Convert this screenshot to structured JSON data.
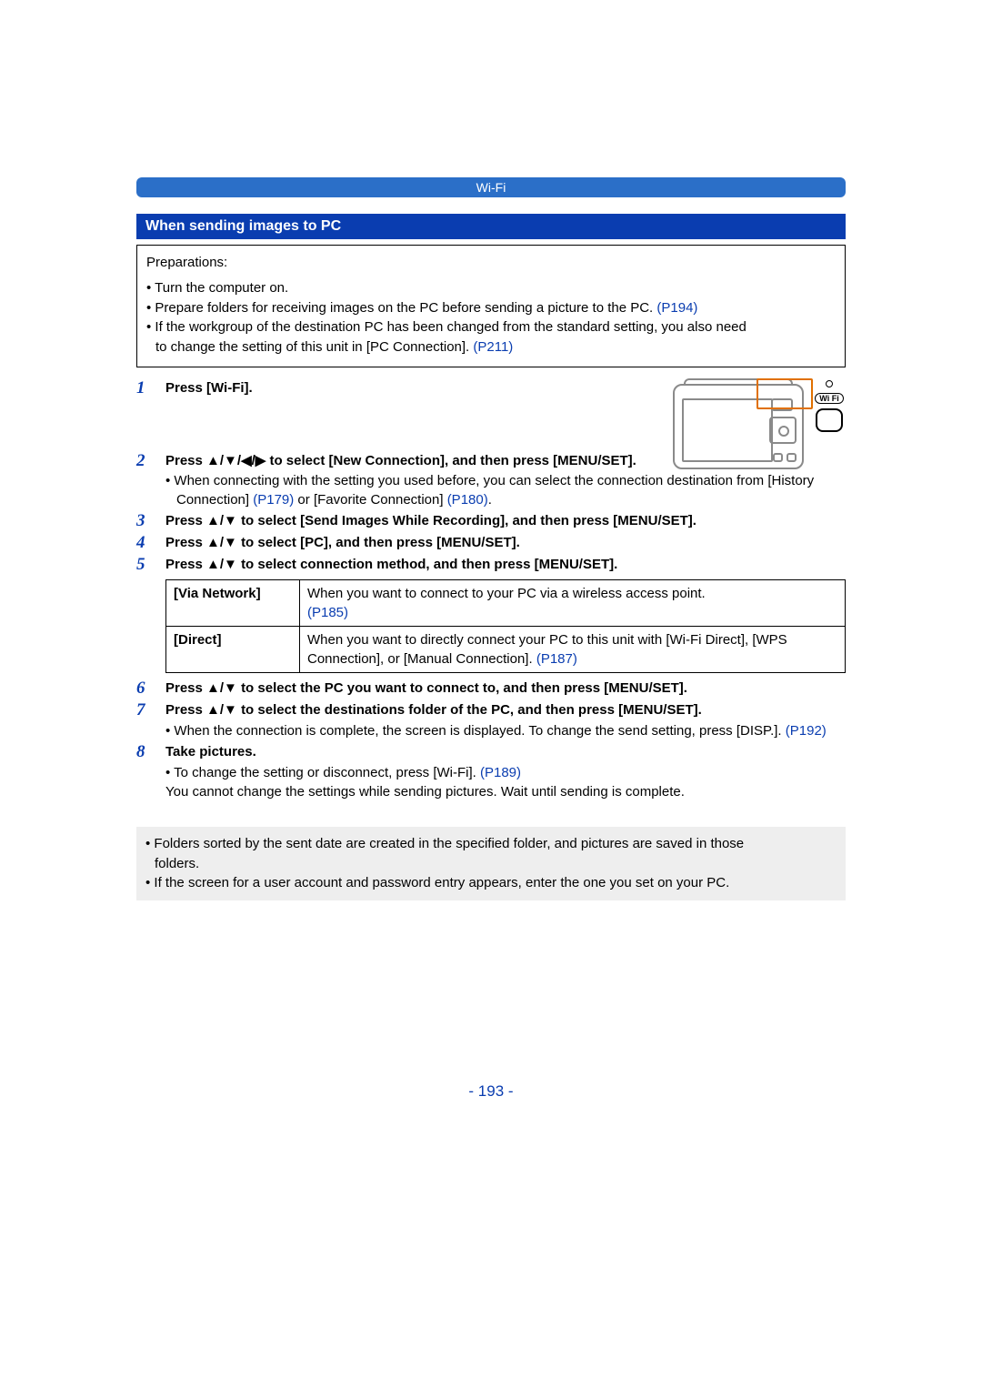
{
  "header": {
    "category": "Wi-Fi"
  },
  "section_title": "When sending images to PC",
  "preparations": {
    "title": "Preparations:",
    "items": [
      {
        "text": "Turn the computer on."
      },
      {
        "text_before": "Prepare folders for receiving images on the PC before sending a picture to the PC. ",
        "link": "(P194)"
      },
      {
        "text_before": "If the workgroup of the destination PC has been changed from the standard setting, you also need",
        "text_cont": "to change the setting of this unit in [PC Connection]. ",
        "link": "(P211)"
      }
    ]
  },
  "steps": [
    {
      "n": "1",
      "bold": "Press [Wi-Fi]."
    },
    {
      "n": "2",
      "bold": "Press ▲/▼/◀/▶ to select [New Connection], and then press [MENU/SET].",
      "note_before": "When connecting with the setting you used before, you can select the connection destination from [History Connection] ",
      "link1": "(P179)",
      "note_mid": " or [Favorite Connection] ",
      "link2": "(P180)",
      "note_after": "."
    },
    {
      "n": "3",
      "bold": "Press ▲/▼ to select [Send Images While Recording], and then press [MENU/SET]."
    },
    {
      "n": "4",
      "bold": "Press ▲/▼ to select [PC], and then press [MENU/SET]."
    },
    {
      "n": "5",
      "bold": "Press ▲/▼ to select connection method, and then press [MENU/SET].",
      "table": {
        "via_network": {
          "label": "[Via Network]",
          "text": "When you want to connect to your PC via a wireless access point. ",
          "link": "(P185)"
        },
        "direct": {
          "label": "[Direct]",
          "text_before": "When you want to directly connect your PC to this unit with [Wi-Fi Direct], [WPS Connection], or [Manual Connection]. ",
          "link": "(P187)"
        }
      }
    },
    {
      "n": "6",
      "bold": "Press ▲/▼ to select the PC you want to connect to, and then press [MENU/SET]."
    },
    {
      "n": "7",
      "bold": "Press ▲/▼ to select the destinations folder of the PC, and then press [MENU/SET].",
      "note_before": "When the connection is complete, the screen is displayed. To change the send setting, press [DISP.]. ",
      "link": "(P192)"
    },
    {
      "n": "8",
      "bold": "Take pictures.",
      "note_before": "To change the setting or disconnect, press [Wi-Fi]. ",
      "link": "(P189)",
      "note2": "You cannot change the settings while sending pictures. Wait until sending is complete."
    }
  ],
  "bottom_notes": {
    "items": [
      {
        "line1": "Folders sorted by the sent date are created in the specified folder, and pictures are saved in those",
        "line2": "folders."
      },
      {
        "line1": "If the screen for a user account and password entry appears, enter the one you set on your PC."
      }
    ]
  },
  "wifi_label": "Wi Fi",
  "page_number": "- 193 -"
}
